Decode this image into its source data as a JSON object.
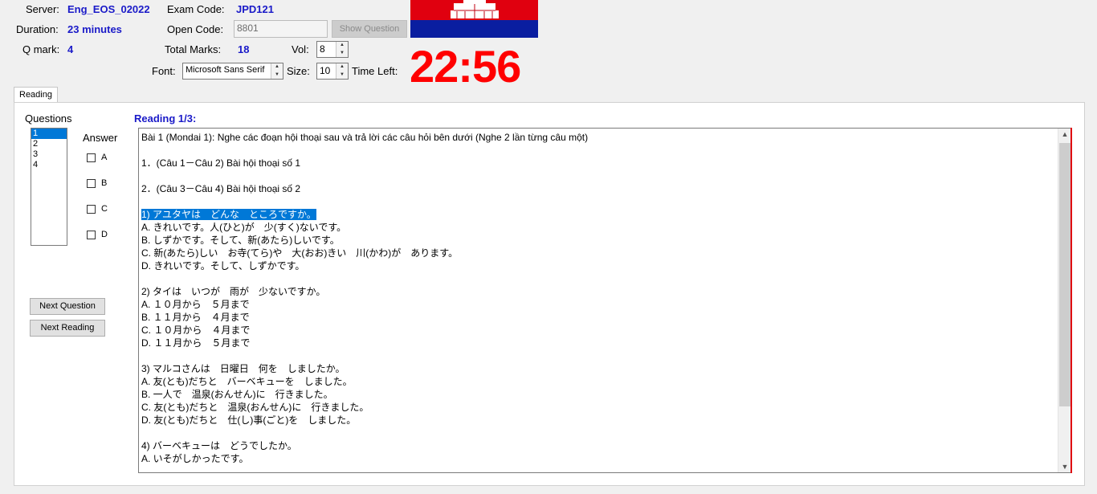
{
  "header": {
    "server_label": "Server:",
    "server_value": "Eng_EOS_02022",
    "duration_label": "Duration:",
    "duration_value": "23 minutes",
    "qmark_label": "Q mark:",
    "qmark_value": "4",
    "exam_code_label": "Exam Code:",
    "exam_code_value": "JPD121",
    "open_code_label": "Open Code:",
    "open_code_value": "8801",
    "show_question_label": "Show Question",
    "total_marks_label": "Total Marks:",
    "total_marks_value": "18",
    "vol_label": "Vol:",
    "vol_value": "8",
    "font_label": "Font:",
    "font_value": "Microsoft Sans Serif",
    "size_label": "Size:",
    "size_value": "10",
    "time_left_label": "Time Left:",
    "timer": "22:56"
  },
  "colors": {
    "flag_red": "#e0000f",
    "flag_blue": "#0a1ea0",
    "timer": "#ff0000",
    "accent": "#1a1ac8",
    "selection": "#0078d7"
  },
  "tabs": [
    "Reading"
  ],
  "questions": {
    "label": "Questions",
    "items": [
      "1",
      "2",
      "3",
      "4"
    ],
    "selected": "1"
  },
  "answer": {
    "label": "Answer",
    "options": [
      "A",
      "B",
      "C",
      "D"
    ]
  },
  "buttons": {
    "next_question": "Next Question",
    "next_reading": "Next Reading"
  },
  "reading": {
    "title": "Reading 1/3:",
    "lines": [
      "Bài 1 (Mondai 1): Nghe các đoạn hội thoại sau và trả lời các câu hỏi bên dưới (Nghe 2 lần từng câu một)",
      "",
      "1．(Câu 1－Câu 2) Bài hội thoại số 1",
      "",
      "2．(Câu 3－Câu 4) Bài hội thoại số 2",
      "",
      "1) アユタヤは　どんな　ところですか。",
      "A. きれいです。人(ひと)が　少(すく)ないです。",
      "B. しずかです。そして、新(あたら)しいです。",
      "C. 新(あたら)しい　お寺(てら)や　大(おお)きい　川(かわ)が　あります。",
      "D. きれいです。そして、しずかです。",
      "",
      "2) タイは　いつが　雨が　少ないですか。",
      "A. １０月から　５月まで",
      "B. １１月から　４月まで",
      "C. １０月から　４月まで",
      "D. １１月から　５月まで",
      "",
      "3) マルコさんは　日曜日　何を　しましたか。",
      "A. 友(とも)だちと　バーベキューを　しました。",
      "B. 一人で　温泉(おんせん)に　行きました。",
      "C. 友(とも)だちと　温泉(おんせん)に　行きました。",
      "D. 友(とも)だちと　仕(し)事(ごと)を　しました。",
      "",
      "4) バーベキューは　どうでしたか。",
      "A. いそがしかったです。"
    ],
    "highlighted_line": 6
  }
}
